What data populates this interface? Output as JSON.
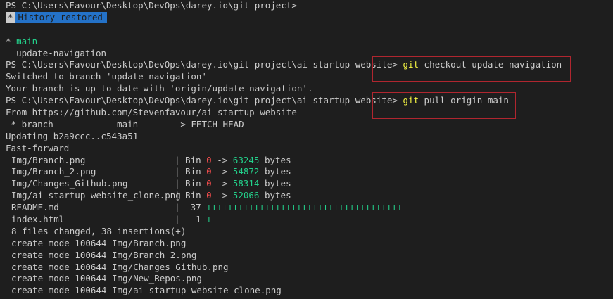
{
  "terminal": {
    "prompt1": "PS C:\\Users\\Favour\\Desktop\\DevOps\\darey.io\\git-project>",
    "banner_star": "*",
    "banner_text": "History restored",
    "branch_current_marker": "* ",
    "branch_current": "main",
    "branch_other": "update-navigation",
    "prompt2": "PS C:\\Users\\Favour\\Desktop\\DevOps\\darey.io\\git-project\\ai-startup-website>",
    "cmd1_git": "git",
    "cmd1_rest": " checkout update-navigation",
    "switched": "Switched to branch 'update-navigation'",
    "uptodate": "Your branch is up to date with 'origin/update-navigation'.",
    "prompt3": "PS C:\\Users\\Favour\\Desktop\\DevOps\\darey.io\\git-project\\ai-startup-website>",
    "cmd2_git": "git",
    "cmd2_rest": " pull origin main",
    "from": "From https://github.com/Stevenfavour/ai-startup-website",
    "fetch_line": " * branch            main       -> FETCH_HEAD",
    "updating": "Updating b2a9ccc..c543a51",
    "fastforward": "Fast-forward",
    "files": [
      {
        "name": "Img/Branch.png",
        "sep": "| Bin ",
        "old": "0",
        "arrow": " -> ",
        "new": "63245",
        "unit": " bytes"
      },
      {
        "name": "Img/Branch_2.png",
        "sep": "| Bin ",
        "old": "0",
        "arrow": " -> ",
        "new": "54872",
        "unit": " bytes"
      },
      {
        "name": "Img/Changes_Github.png",
        "sep": "| Bin ",
        "old": "0",
        "arrow": " -> ",
        "new": "58314",
        "unit": " bytes"
      },
      {
        "name": "Img/ai-startup-website_clone.png",
        "sep": "| Bin ",
        "old": "0",
        "arrow": " -> ",
        "new": "52066",
        "unit": " bytes"
      }
    ],
    "readme_name": "README.md",
    "readme_count": "|  37 ",
    "readme_plus": "+++++++++++++++++++++++++++++++++++++",
    "index_name": "index.html",
    "index_count": "|   1 ",
    "index_plus": "+",
    "summary": "8 files changed, 38 insertions(+)",
    "creates": [
      "create mode 100644 Img/Branch.png",
      "create mode 100644 Img/Branch_2.png",
      "create mode 100644 Img/Changes_Github.png",
      "create mode 100644 Img/New_Repos.png",
      "create mode 100644 Img/ai-startup-website_clone.png"
    ],
    "colors": {
      "background": "#1e1e1e",
      "text": "#cccccc",
      "green": "#23d18b",
      "yellow": "#f5f543",
      "red": "#f14c4c",
      "banner": "#2472c8",
      "highlight_box": "#b0262f"
    }
  }
}
